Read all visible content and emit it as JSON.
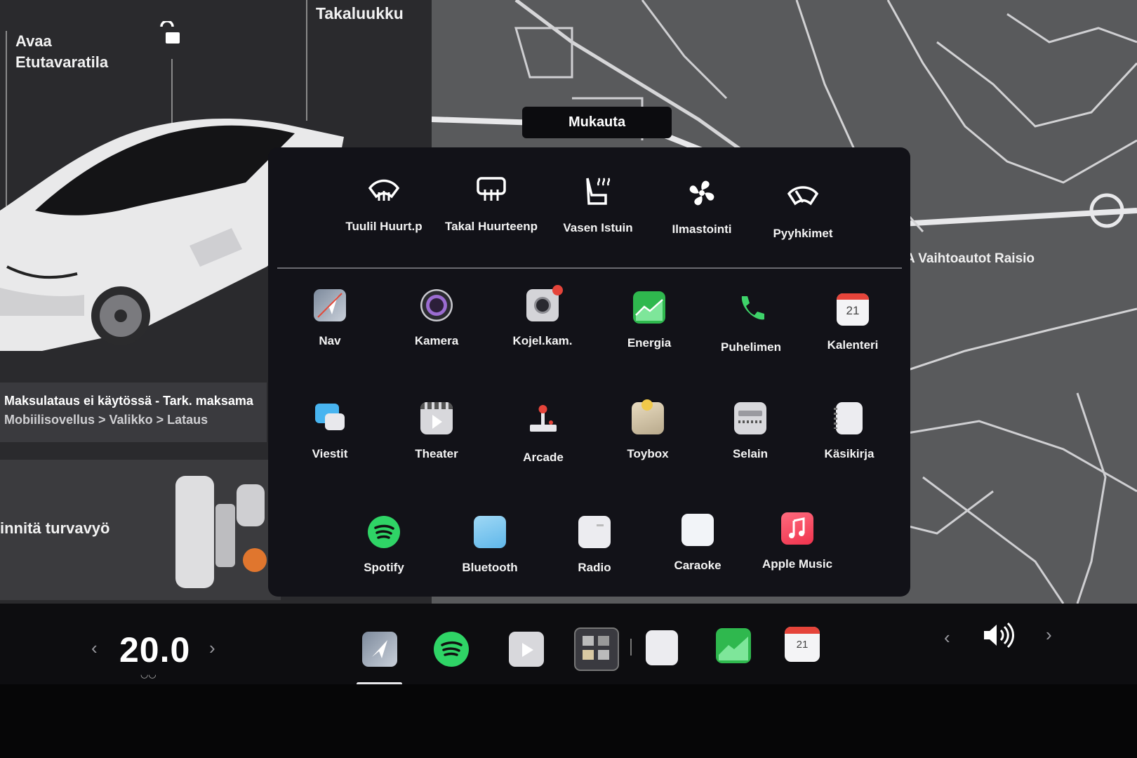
{
  "car_panel": {
    "unlock_front": "Avaa\nEtutavaratila",
    "trunk": "Takaluukku",
    "charging_line1": "Maksulataus ei käytössä - Tark. maksama",
    "charging_line2": "Mobiilisovellus > Valikko > Lataus",
    "seatbelt": "innitä turvavyö"
  },
  "map": {
    "place_label": "A Vaihtoautot Raisio"
  },
  "launcher": {
    "customize": "Mukauta",
    "quick_controls": [
      {
        "label": "Tuulil Huurt.p",
        "icon": "front-defrost-icon"
      },
      {
        "label": "Takal Huurteenp",
        "icon": "rear-defrost-icon"
      },
      {
        "label": "Vasen Istuin",
        "icon": "seat-heater-icon"
      },
      {
        "label": "Ilmastointi",
        "icon": "fan-icon"
      },
      {
        "label": "Pyyhkimet",
        "icon": "wiper-icon"
      }
    ],
    "apps_row1": [
      {
        "label": "Nav"
      },
      {
        "label": "Kamera"
      },
      {
        "label": "Kojel.kam."
      },
      {
        "label": "Energia"
      },
      {
        "label": "Puhelimen"
      },
      {
        "label": "Kalenteri",
        "day": "21"
      }
    ],
    "apps_row2": [
      {
        "label": "Viestit"
      },
      {
        "label": "Theater"
      },
      {
        "label": "Arcade"
      },
      {
        "label": "Toybox"
      },
      {
        "label": "Selain"
      },
      {
        "label": "Käsikirja"
      }
    ],
    "apps_row3": [
      {
        "label": "Spotify"
      },
      {
        "label": "Bluetooth"
      },
      {
        "label": "Radio"
      },
      {
        "label": "Caraoke"
      },
      {
        "label": "Apple Music"
      }
    ]
  },
  "taskbar": {
    "temperature": "20.0",
    "calendar_day": "21"
  }
}
